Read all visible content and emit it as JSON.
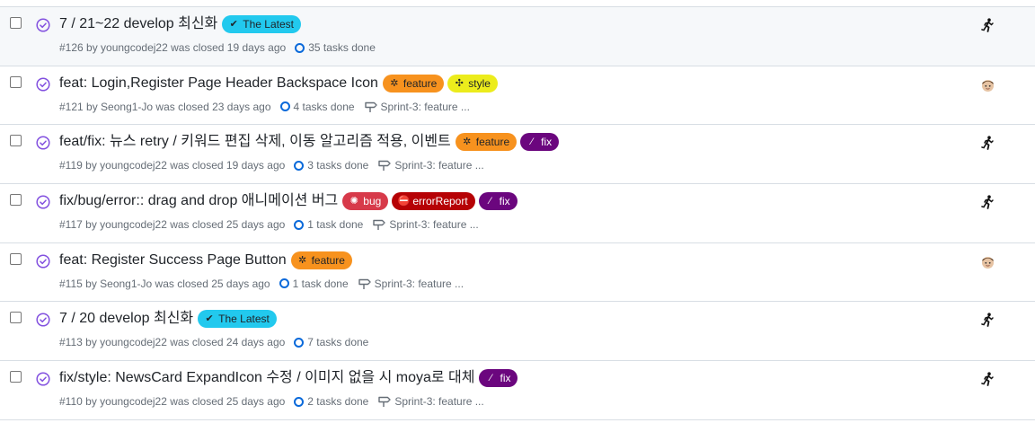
{
  "colors": {
    "closed_purple": "#8250df",
    "progress_blue": "#0969da",
    "meta_gray": "#656d76"
  },
  "issues": [
    {
      "title": "7 / 21~22 develop 최신화",
      "labels": [
        {
          "glyph": "✔",
          "text": "The Latest",
          "bg": "#22c9ee",
          "fg": "#1f2328"
        }
      ],
      "meta": "#126 by youngcodej22 was closed 19 days ago",
      "tasks": "35 tasks done",
      "milestone": "",
      "avatar": "runner-avatar-icon"
    },
    {
      "title": "feat: Login,Register Page Header Backspace Icon",
      "labels": [
        {
          "glyph": "✲",
          "text": "feature",
          "bg": "#f7921e",
          "fg": "#1f2328"
        },
        {
          "glyph": "✣",
          "text": "style",
          "bg": "#ecec1c",
          "fg": "#1f2328"
        }
      ],
      "meta": "#121 by Seong1-Jo was closed 23 days ago",
      "tasks": "4 tasks done",
      "milestone": "Sprint-3: feature ...",
      "avatar": "face-avatar-icon"
    },
    {
      "title": "feat/fix: 뉴스 retry / 키워드 편집 삭제, 이동 알고리즘 적용, 이벤트",
      "labels": [
        {
          "glyph": "✲",
          "text": "feature",
          "bg": "#f7921e",
          "fg": "#1f2328"
        },
        {
          "glyph": "⁄",
          "text": "fix",
          "bg": "#6b067e",
          "fg": "#ffffff"
        }
      ],
      "meta": "#119 by youngcodej22 was closed 19 days ago",
      "tasks": "3 tasks done",
      "milestone": "Sprint-3: feature ...",
      "avatar": "runner-avatar-icon"
    },
    {
      "title": "fix/bug/error:: drag and drop 애니메이션 버그",
      "labels": [
        {
          "glyph": "✺",
          "text": "bug",
          "bg": "#d73a4a",
          "fg": "#ffffff"
        },
        {
          "glyph": "⛔",
          "text": "errorReport",
          "bg": "#b60205",
          "fg": "#ffffff"
        },
        {
          "glyph": "⁄",
          "text": "fix",
          "bg": "#6b067e",
          "fg": "#ffffff"
        }
      ],
      "meta": "#117 by youngcodej22 was closed 25 days ago",
      "tasks": "1 task done",
      "milestone": "Sprint-3: feature ...",
      "avatar": "runner-avatar-icon"
    },
    {
      "title": "feat: Register Success Page Button",
      "labels": [
        {
          "glyph": "✲",
          "text": "feature",
          "bg": "#f7921e",
          "fg": "#1f2328"
        }
      ],
      "meta": "#115 by Seong1-Jo was closed 25 days ago",
      "tasks": "1 task done",
      "milestone": "Sprint-3: feature ...",
      "avatar": "face-avatar-icon"
    },
    {
      "title": "7 / 20 develop 최신화",
      "labels": [
        {
          "glyph": "✔",
          "text": "The Latest",
          "bg": "#22c9ee",
          "fg": "#1f2328"
        }
      ],
      "meta": "#113 by youngcodej22 was closed 24 days ago",
      "tasks": "7 tasks done",
      "milestone": "",
      "avatar": "runner-avatar-icon"
    },
    {
      "title": "fix/style: NewsCard ExpandIcon 수정 / 이미지 없을 시 moya로 대체",
      "labels": [
        {
          "glyph": "⁄",
          "text": "fix",
          "bg": "#6b067e",
          "fg": "#ffffff"
        }
      ],
      "meta": "#110 by youngcodej22 was closed 25 days ago",
      "tasks": "2 tasks done",
      "milestone": "Sprint-3: feature ...",
      "avatar": "runner-avatar-icon"
    }
  ]
}
